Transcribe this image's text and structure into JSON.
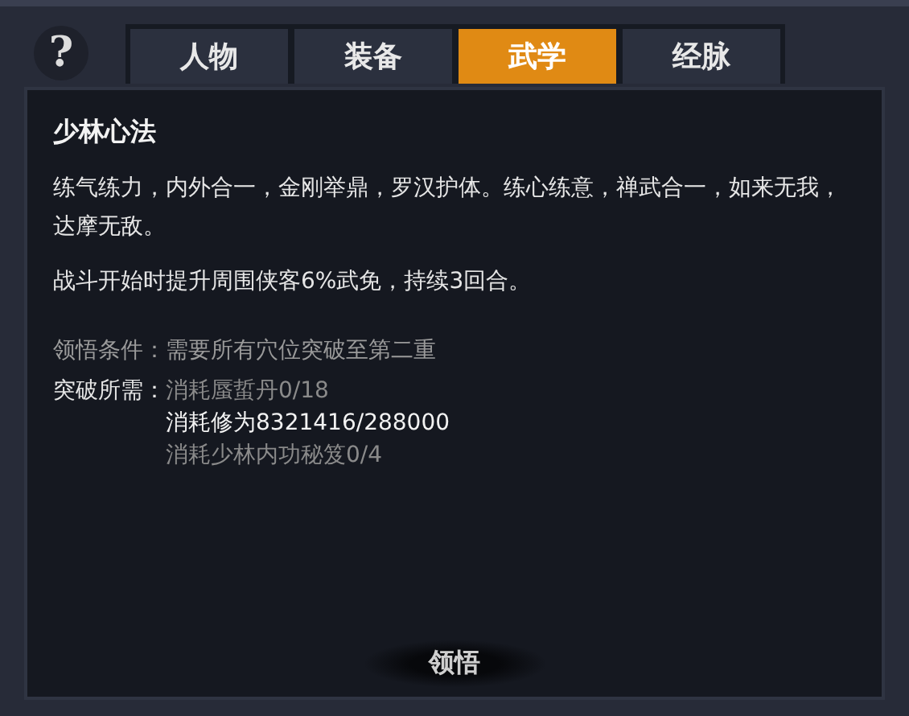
{
  "help_button": {
    "label": "?"
  },
  "tabs": [
    {
      "label": "人物",
      "selected": false
    },
    {
      "label": "装备",
      "selected": false
    },
    {
      "label": "武学",
      "selected": true
    },
    {
      "label": "经脉",
      "selected": false
    }
  ],
  "skill": {
    "title": "少林心法",
    "description": "练气练力，内外合一，金刚举鼎，罗汉护体。练心练意，禅武合一，如来无我，达摩无敌。",
    "effect": "战斗开始时提升周围侠客6%武免，持续3回合。",
    "condition": "领悟条件：需要所有穴位突破至第二重",
    "requirements_label": "突破所需：",
    "requirements": [
      {
        "text": "消耗蜃蜇丹0/18",
        "met": false
      },
      {
        "text": "消耗修为8321416/288000",
        "met": true
      },
      {
        "text": "消耗少林内功秘笈0/4",
        "met": false
      }
    ]
  },
  "action_button": {
    "label": "领悟"
  }
}
